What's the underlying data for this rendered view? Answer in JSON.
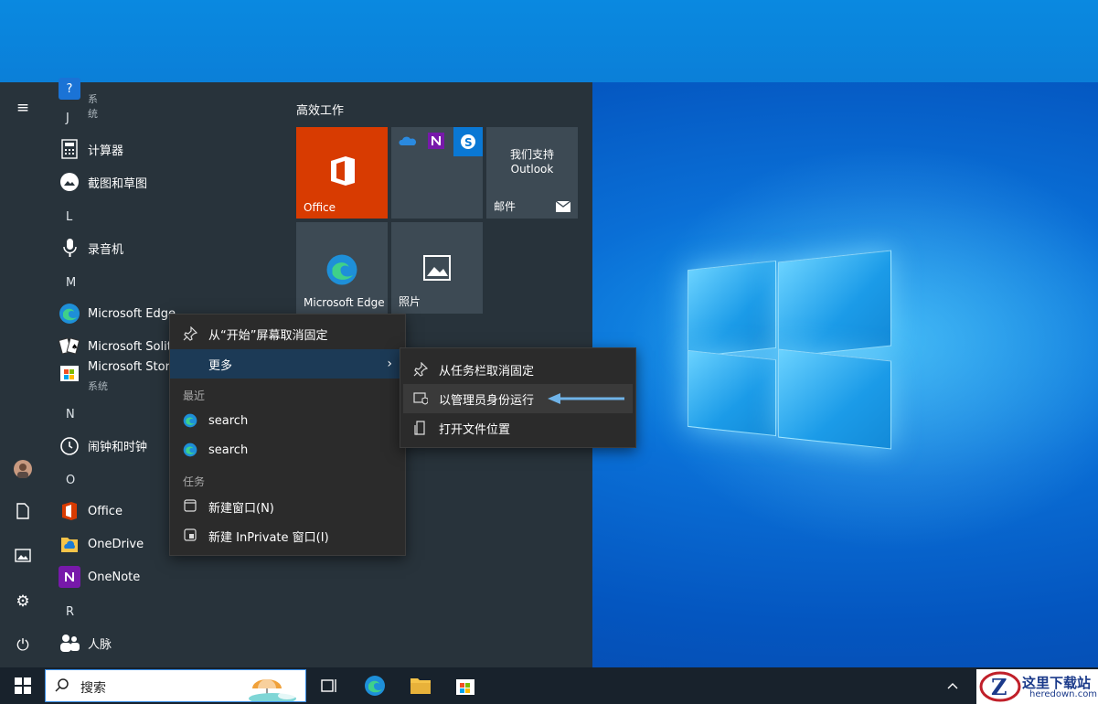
{
  "applist": {
    "items": [
      {
        "type": "app-sub",
        "label": "",
        "sub": "系统"
      },
      {
        "type": "letter",
        "label": "J"
      },
      {
        "type": "app",
        "label": "计算器",
        "icon": "calculator-icon"
      },
      {
        "type": "app",
        "label": "截图和草图",
        "icon": "snip-sketch-icon"
      },
      {
        "type": "letter",
        "label": "L"
      },
      {
        "type": "app",
        "label": "录音机",
        "icon": "voice-recorder-icon"
      },
      {
        "type": "letter",
        "label": "M"
      },
      {
        "type": "app",
        "label": "Microsoft Edge",
        "icon": "edge-icon"
      },
      {
        "type": "app",
        "label": "Microsoft Solita",
        "icon": "solitaire-icon"
      },
      {
        "type": "app",
        "label": "Microsoft Store",
        "sub": "系统",
        "icon": "store-icon"
      },
      {
        "type": "letter",
        "label": "N"
      },
      {
        "type": "app",
        "label": "闹钟和时钟",
        "icon": "alarm-clock-icon"
      },
      {
        "type": "letter",
        "label": "O"
      },
      {
        "type": "app",
        "label": "Office",
        "icon": "office-icon"
      },
      {
        "type": "app",
        "label": "OneDrive",
        "icon": "onedrive-icon"
      },
      {
        "type": "app",
        "label": "OneNote",
        "icon": "onenote-icon"
      },
      {
        "type": "letter",
        "label": "R"
      },
      {
        "type": "app",
        "label": "人脉",
        "icon": "people-icon"
      }
    ]
  },
  "tiles": {
    "group_title": "高效工作",
    "office": "Office",
    "mail_line1": "我们支持",
    "mail_line2": "Outlook",
    "mail": "邮件",
    "edge": "Microsoft Edge",
    "photos": "照片"
  },
  "context_menu": {
    "unpin_start": "从“开始”屏幕取消固定",
    "more": "更多",
    "recent_header": "最近",
    "recent": [
      "search",
      "search"
    ],
    "tasks_header": "任务",
    "new_window": "新建窗口(N)",
    "new_inprivate": "新建 InPrivate 窗口(I)"
  },
  "submenu": {
    "unpin_taskbar": "从任务栏取消固定",
    "run_as_admin": "以管理员身份运行",
    "open_location": "打开文件位置"
  },
  "taskbar": {
    "search_placeholder": "搜索"
  },
  "watermark": {
    "title": "这里下载站",
    "url": "heredown.com"
  },
  "colors": {
    "start_bg": "#28333b",
    "tile_bg": "#3d4a54",
    "office_orange": "#d83b01",
    "highlight": "#3a3a3a",
    "arrow": "#6fb3e8"
  }
}
